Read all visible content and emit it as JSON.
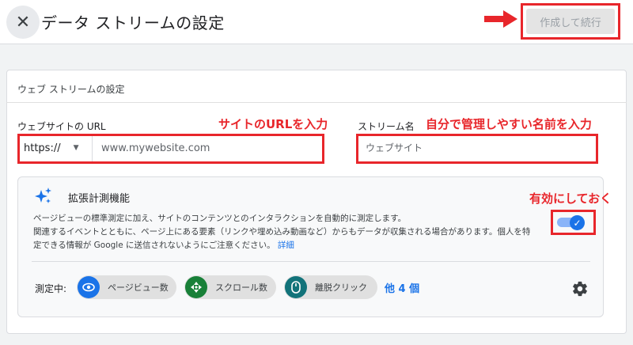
{
  "header": {
    "close_icon": "close-icon",
    "title": "データ ストリームの設定",
    "create_button": "作成して続行"
  },
  "form": {
    "section_title": "ウェブ ストリームの設定",
    "url_label": "ウェブサイトの URL",
    "url_annotation": "サイトのURLを入力",
    "protocol_value": "https://",
    "url_placeholder": "www.mywebsite.com",
    "stream_label": "ストリーム名",
    "stream_annotation": "自分で管理しやすい名前を入力",
    "stream_placeholder": "ウェブサイト"
  },
  "enhanced_measurement": {
    "icon": "sparkle-icon",
    "title": "拡張計測機能",
    "annotation": "有効にしておく",
    "desc_line1": "ページビューの標準測定に加え、サイトのコンテンツとのインタラクションを自動的に測定します。",
    "desc_line2": "関連するイベントとともに、ページ上にある要素（リンクや埋め込み動画など）からもデータが収集される場合があります。個人を特",
    "desc_line3": "定できる情報が Google に送信されないようにご注意ください。",
    "details_link": "詳細",
    "toggle_on": true,
    "measuring_label": "測定中:",
    "chips": [
      {
        "label": "ページビュー数",
        "icon": "eye-icon",
        "color": "#1a73e8"
      },
      {
        "label": "スクロール数",
        "icon": "scroll-icon",
        "color": "#188038"
      },
      {
        "label": "離脱クリック",
        "icon": "mouse-icon",
        "color": "#12737a"
      }
    ],
    "more_link": "他 4 個",
    "settings_icon": "gear-icon"
  },
  "colors": {
    "annotation": "#e8262b",
    "accent": "#1a73e8"
  }
}
